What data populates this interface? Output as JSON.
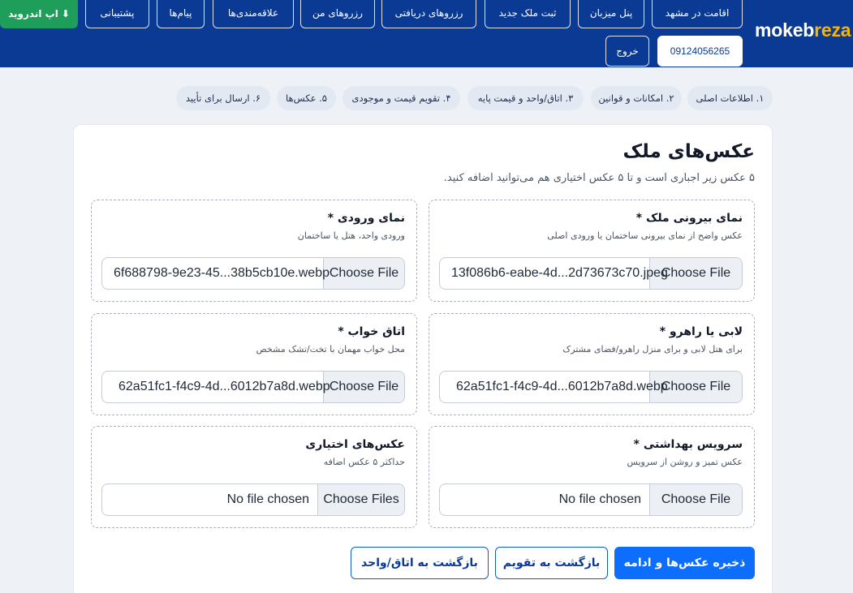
{
  "brand": {
    "logo_part1": "mokeb",
    "logo_part2": "reza"
  },
  "nav": {
    "android_label": "اپ اندروید",
    "android_icon": "download-arrow-icon",
    "items": [
      "اقامت در مشهد",
      "پنل میزبان",
      "ثبت ملک جدید",
      "رزروهای دریافتی",
      "رزروهای من",
      "علاقه‌مندی‌ها",
      "پیام‌ها",
      "پشتیبانی"
    ],
    "phone": "09124056265",
    "logout": "خروج"
  },
  "steps": [
    "۱. اطلاعات اصلی",
    "۲. امکانات و قوانین",
    "۳. اتاق/واحد و قیمت پایه",
    "۴. تقویم قیمت و موجودی",
    "۵. عکس‌ها",
    "۶. ارسال برای تأیید"
  ],
  "page": {
    "title": "عکس‌های ملک",
    "subtitle": "۵ عکس زیر اجباری است و تا ۵ عکس اختیاری هم می‌توانید اضافه کنید."
  },
  "slots": [
    {
      "title": "نمای بیرونی ملک *",
      "hint": "عکس واضح از نمای بیرونی ساختمان یا ورودی اصلی",
      "button": "Choose File",
      "file": "13f086b6-eabe-4d...2d73673c70.jpeg"
    },
    {
      "title": "نمای ورودی *",
      "hint": "ورودی واحد، هتل یا ساختمان",
      "button": "Choose File",
      "file": "6f688798-9e23-45...38b5cb10e.webp"
    },
    {
      "title": "لابی یا راهرو *",
      "hint": "برای هتل لابی و برای منزل راهرو/فضای مشترک",
      "button": "Choose File",
      "file": "62a51fc1-f4c9-4d...6012b7a8d.webp"
    },
    {
      "title": "اتاق خواب *",
      "hint": "محل خواب مهمان با تخت/تشک مشخص",
      "button": "Choose File",
      "file": "62a51fc1-f4c9-4d...6012b7a8d.webp"
    },
    {
      "title": "سرویس بهداشتی *",
      "hint": "عکس تمیز و روشن از سرویس",
      "button": "Choose File",
      "file": "No file chosen"
    },
    {
      "title": "عکس‌های اختیاری",
      "hint": "حداکثر ۵ عکس اضافه",
      "button": "Choose Files",
      "file": "No file chosen"
    }
  ],
  "actions": {
    "save": "ذخیره عکس‌ها و ادامه",
    "back_calendar": "بازگشت به تقویم",
    "back_room": "بازگشت به اتاق/واحد"
  },
  "colors": {
    "header_bg": "#0b3a94",
    "brand_accent": "#f6b500",
    "android_green": "#1e9e5a",
    "primary_blue": "#0d6efd",
    "step_bg": "#e3e9f3",
    "page_bg": "#eef2f7"
  }
}
